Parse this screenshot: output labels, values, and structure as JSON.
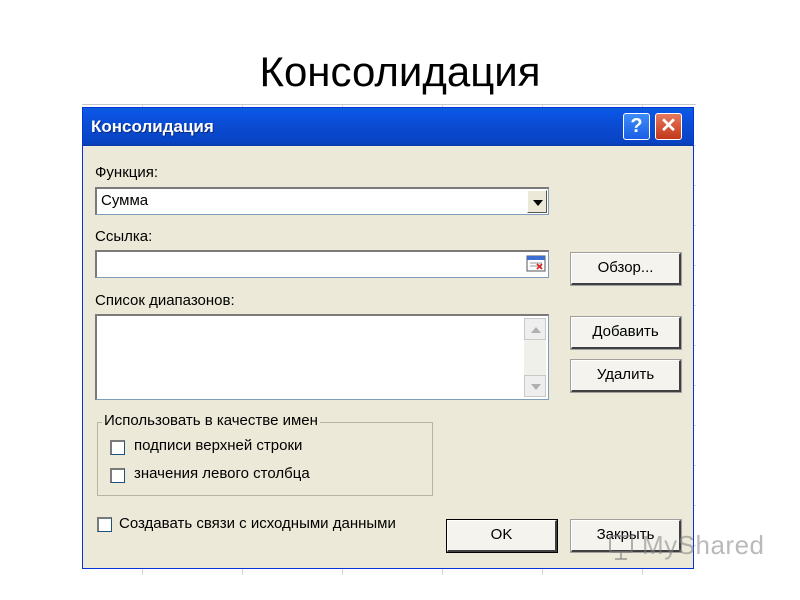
{
  "slide": {
    "title": "Консолидация"
  },
  "dialog": {
    "title": "Консолидация",
    "help_glyph": "?",
    "close_glyph": "✕",
    "function": {
      "label": "Функция:",
      "value": "Сумма"
    },
    "reference": {
      "label": "Ссылка:",
      "value": ""
    },
    "browse_label": "Обзор...",
    "ranges": {
      "label": "Список диапазонов:",
      "items": []
    },
    "add_label": "Добавить",
    "delete_label": "Удалить",
    "use_labels": {
      "legend": "Использовать в качестве имен",
      "top_row": {
        "label": "подписи верхней строки",
        "checked": false
      },
      "left_column": {
        "label": "значения левого столбца",
        "checked": false
      }
    },
    "create_links": {
      "label": "Создавать связи с исходными данными",
      "checked": false
    },
    "ok_label": "OK",
    "close_label": "Закрыть"
  },
  "watermark": {
    "text": "MyShared"
  }
}
